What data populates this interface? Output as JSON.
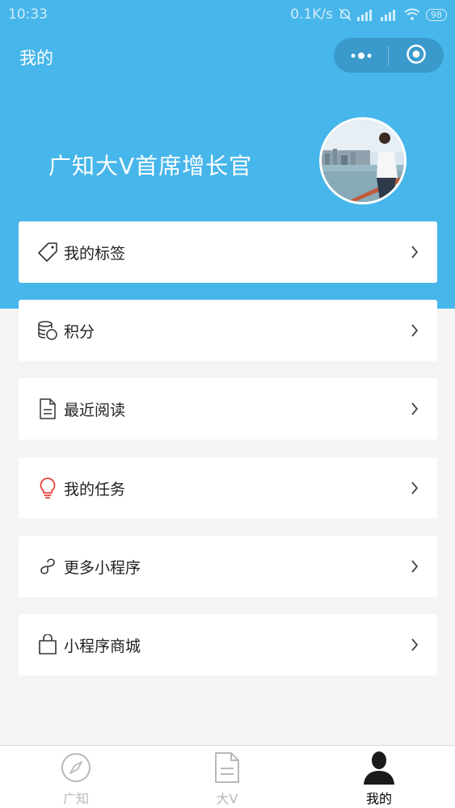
{
  "status_bar": {
    "time": "10:33",
    "network_speed": "0.1K/s",
    "battery": "98"
  },
  "nav": {
    "title": "我的"
  },
  "profile": {
    "name": "广知大V首席增长官"
  },
  "menu": {
    "items": [
      {
        "label": "我的标签",
        "icon": "tag-icon"
      },
      {
        "label": "积分",
        "icon": "coins-icon"
      },
      {
        "label": "最近阅读",
        "icon": "document-icon"
      },
      {
        "label": "我的任务",
        "icon": "lightbulb-icon"
      },
      {
        "label": "更多小程序",
        "icon": "mini-program-icon"
      },
      {
        "label": "小程序商城",
        "icon": "shopping-bag-icon"
      }
    ]
  },
  "tabs": [
    {
      "label": "广知",
      "icon": "compass-icon",
      "active": false
    },
    {
      "label": "大V",
      "icon": "document-icon",
      "active": false
    },
    {
      "label": "我的",
      "icon": "person-icon",
      "active": true
    }
  ],
  "colors": {
    "header_blue": "#47b6ea",
    "capsule_blue": "#3a9acb",
    "task_icon_red": "#e8453c",
    "tab_inactive": "#b9b9b9"
  }
}
